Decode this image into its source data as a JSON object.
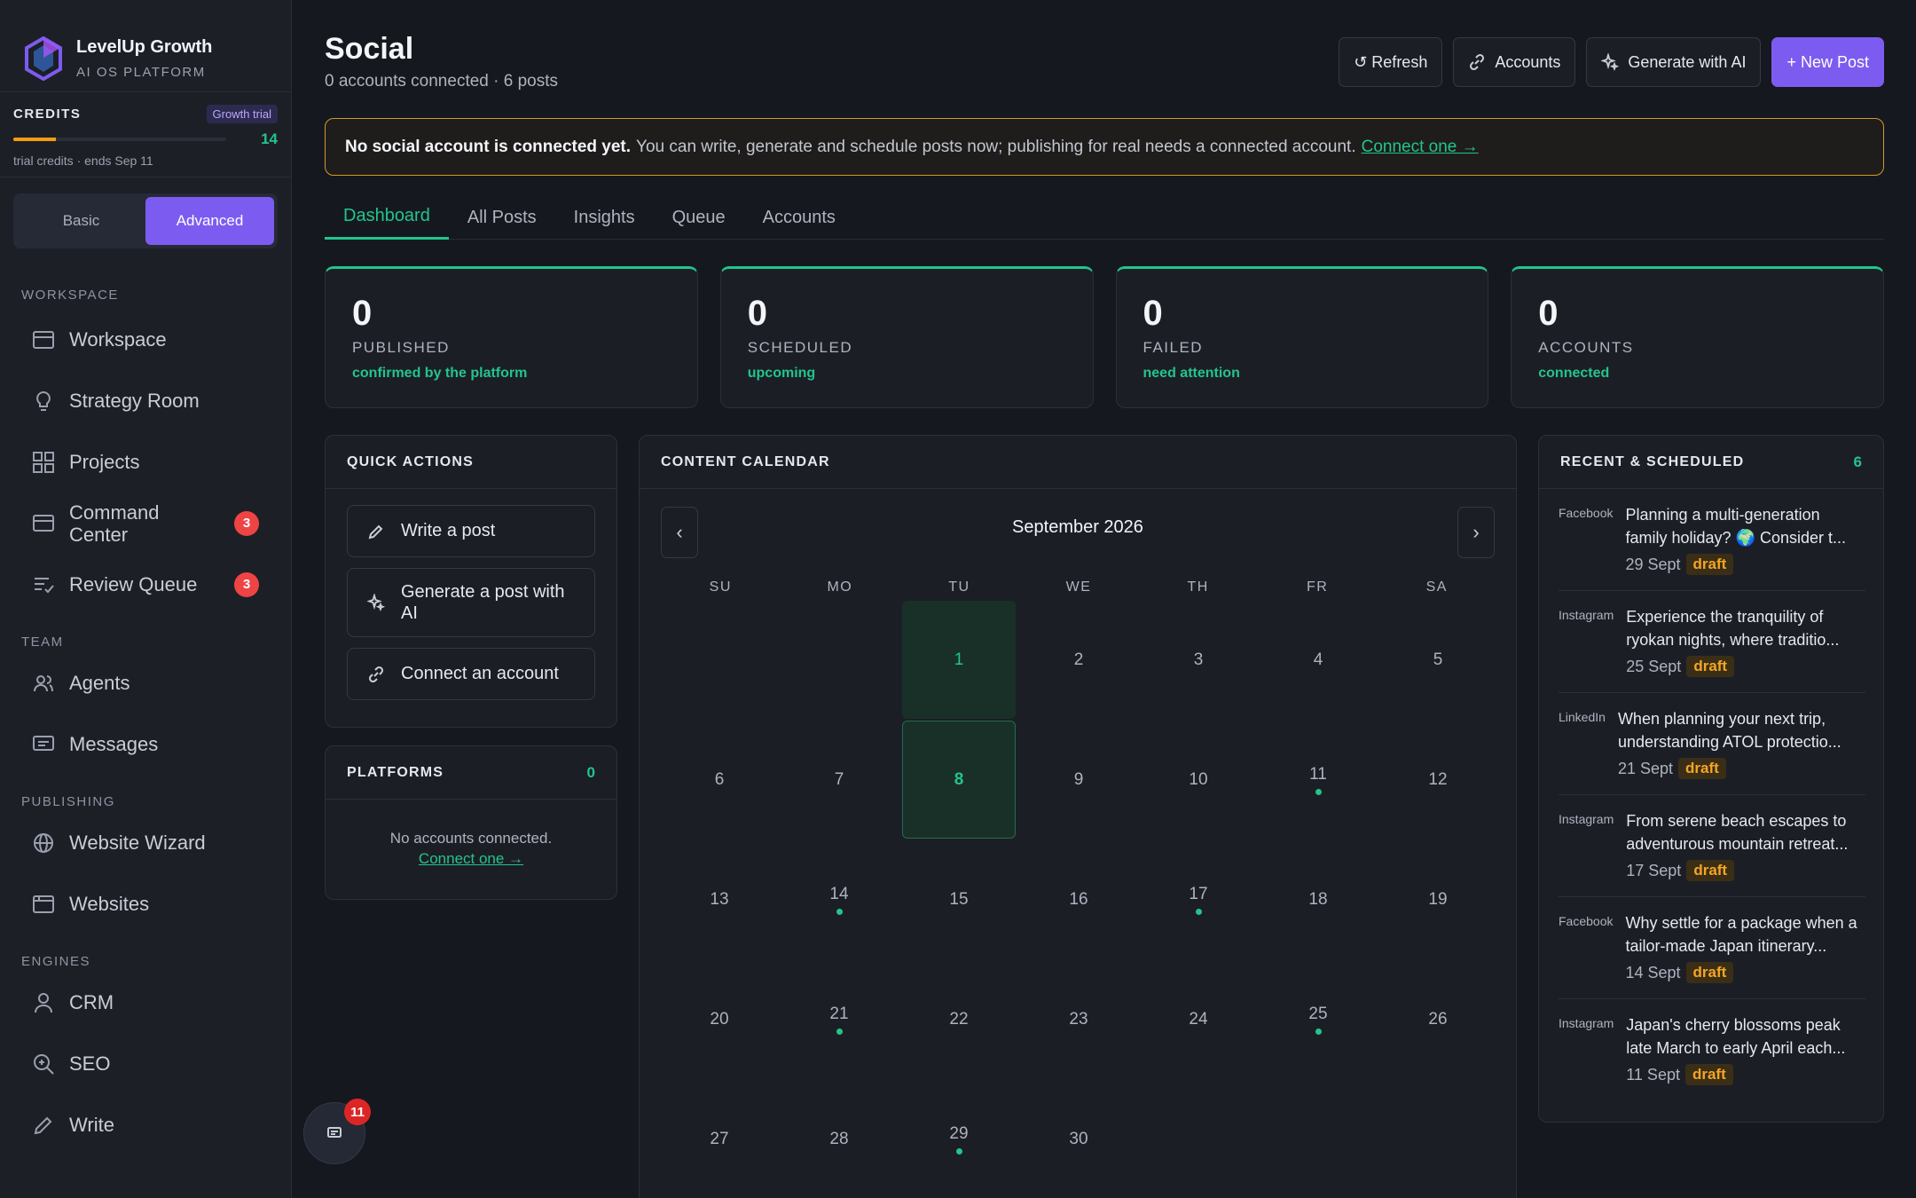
{
  "brand": {
    "name": "LevelUp Growth",
    "subtitle": "AI OS PLATFORM"
  },
  "credits": {
    "label": "CREDITS",
    "badge": "Growth trial",
    "value": "14",
    "fill_fraction": 0.2,
    "note": "trial credits · ends Sep 11"
  },
  "mode": {
    "basic": "Basic",
    "advanced": "Advanced",
    "active": "advanced"
  },
  "sidebar": {
    "workspace_label": "WORKSPACE",
    "workspace": [
      {
        "label": "Workspace",
        "icon": "workspace-icon"
      },
      {
        "label": "Strategy Room",
        "icon": "lightbulb-icon"
      },
      {
        "label": "Projects",
        "icon": "grid-icon"
      },
      {
        "label": "Command Center",
        "icon": "monitor-icon",
        "badge": "3"
      },
      {
        "label": "Review Queue",
        "icon": "list-check-icon",
        "badge": "3"
      }
    ],
    "team_label": "TEAM",
    "team": [
      {
        "label": "Agents",
        "icon": "users-icon"
      },
      {
        "label": "Messages",
        "icon": "message-icon"
      }
    ],
    "publishing_label": "PUBLISHING",
    "publishing": [
      {
        "label": "Website Wizard",
        "icon": "globe-icon"
      },
      {
        "label": "Websites",
        "icon": "browser-icon"
      }
    ],
    "engines_label": "ENGINES",
    "engines": [
      {
        "label": "CRM",
        "icon": "user-icon"
      },
      {
        "label": "SEO",
        "icon": "search-plus-icon"
      },
      {
        "label": "Write",
        "icon": "pencil-icon"
      }
    ]
  },
  "header": {
    "title": "Social",
    "subtitle": "0 accounts connected · 6 posts",
    "refresh": "↺ Refresh",
    "accounts": "Accounts",
    "generate": "Generate with AI",
    "new_post": "+ New Post"
  },
  "banner": {
    "strong": "No social account is connected yet.",
    "text": "You can write, generate and schedule posts now; publishing for real needs a connected account.",
    "link": "Connect one →"
  },
  "tabs": [
    "Dashboard",
    "All Posts",
    "Insights",
    "Queue",
    "Accounts"
  ],
  "stats": [
    {
      "value": "0",
      "label": "PUBLISHED",
      "note": "confirmed by the platform"
    },
    {
      "value": "0",
      "label": "SCHEDULED",
      "note": "upcoming"
    },
    {
      "value": "0",
      "label": "FAILED",
      "note": "need attention"
    },
    {
      "value": "0",
      "label": "ACCOUNTS",
      "note": "connected"
    }
  ],
  "quick_actions": {
    "title": "QUICK ACTIONS",
    "write": "Write a post",
    "generate": "Generate a post with AI",
    "connect": "Connect an account"
  },
  "platforms": {
    "title": "PLATFORMS",
    "count": "0",
    "empty": "No accounts connected.",
    "link": "Connect one →"
  },
  "calendar": {
    "title": "CONTENT CALENDAR",
    "month": "September 2026",
    "prev": "‹",
    "next": "›",
    "weekdays": [
      "SU",
      "MO",
      "TU",
      "WE",
      "TH",
      "FR",
      "SA"
    ],
    "days": [
      {
        "d": ""
      },
      {
        "d": ""
      },
      {
        "d": "1",
        "style": "tint"
      },
      {
        "d": "2"
      },
      {
        "d": "3"
      },
      {
        "d": "4"
      },
      {
        "d": "5"
      },
      {
        "d": "6"
      },
      {
        "d": "7"
      },
      {
        "d": "8",
        "style": "today"
      },
      {
        "d": "9"
      },
      {
        "d": "10"
      },
      {
        "d": "11",
        "dot": true
      },
      {
        "d": "12"
      },
      {
        "d": "13"
      },
      {
        "d": "14",
        "dot": true
      },
      {
        "d": "15"
      },
      {
        "d": "16"
      },
      {
        "d": "17",
        "dot": true
      },
      {
        "d": "18"
      },
      {
        "d": "19"
      },
      {
        "d": "20"
      },
      {
        "d": "21",
        "dot": true
      },
      {
        "d": "22"
      },
      {
        "d": "23"
      },
      {
        "d": "24"
      },
      {
        "d": "25",
        "dot": true
      },
      {
        "d": "26"
      },
      {
        "d": "27"
      },
      {
        "d": "28"
      },
      {
        "d": "29",
        "dot": true
      },
      {
        "d": "30"
      },
      {
        "d": ""
      },
      {
        "d": ""
      },
      {
        "d": ""
      }
    ]
  },
  "recent": {
    "title": "RECENT & SCHEDULED",
    "count": "6",
    "items": [
      {
        "platform": "Facebook",
        "text": "Planning a multi-generation family holiday? 🌍 Consider t...",
        "date": "29 Sept",
        "status": "draft"
      },
      {
        "platform": "Instagram",
        "text": "Experience the tranquility of ryokan nights, where traditio...",
        "date": "25 Sept",
        "status": "draft"
      },
      {
        "platform": "LinkedIn",
        "text": "When planning your next trip, understanding ATOL protectio...",
        "date": "21 Sept",
        "status": "draft"
      },
      {
        "platform": "Instagram",
        "text": "From serene beach escapes to adventurous mountain retreat...",
        "date": "17 Sept",
        "status": "draft"
      },
      {
        "platform": "Facebook",
        "text": "Why settle for a package when a tailor-made Japan itinerary...",
        "date": "14 Sept",
        "status": "draft"
      },
      {
        "platform": "Instagram",
        "text": "Japan's cherry blossoms peak late March to early April each...",
        "date": "11 Sept",
        "status": "draft"
      }
    ]
  },
  "chat": {
    "badge": "11",
    "icon": "chat-icon"
  },
  "colors": {
    "accent": "#22c58b",
    "brand": "#7c5cf0",
    "warning": "#d4982a",
    "badge": "#ef4444"
  }
}
